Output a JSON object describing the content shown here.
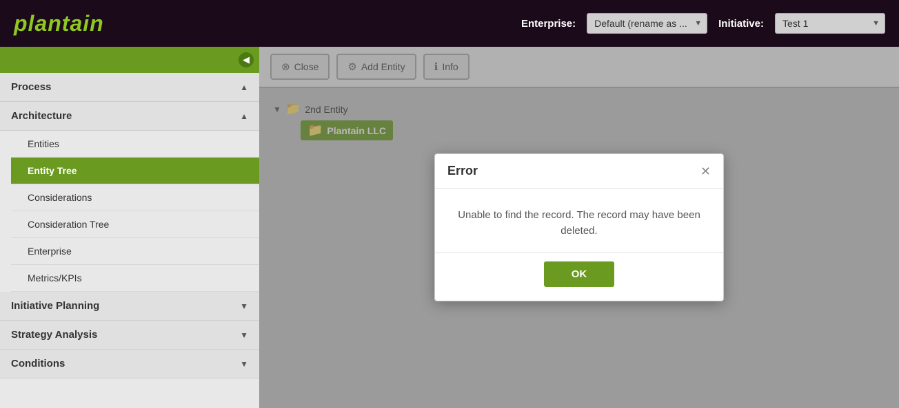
{
  "header": {
    "logo": "plantain",
    "enterprise_label": "Enterprise:",
    "enterprise_value": "Default (rename as ...",
    "initiative_label": "Initiative:",
    "initiative_value": "Test 1"
  },
  "toolbar": {
    "close_label": "Close",
    "add_entity_label": "Add Entity",
    "info_label": "Info"
  },
  "sidebar": {
    "collapse_label": "◀",
    "sections": [
      {
        "id": "process",
        "label": "Process",
        "chevron": "▲",
        "items": []
      },
      {
        "id": "architecture",
        "label": "Architecture",
        "chevron": "▲",
        "items": [
          {
            "id": "entities",
            "label": "Entities",
            "active": false
          },
          {
            "id": "entity-tree",
            "label": "Entity Tree",
            "active": true
          },
          {
            "id": "considerations",
            "label": "Considerations",
            "active": false
          },
          {
            "id": "consideration-tree",
            "label": "Consideration Tree",
            "active": false
          },
          {
            "id": "enterprise",
            "label": "Enterprise",
            "active": false
          },
          {
            "id": "metrics-kpis",
            "label": "Metrics/KPIs",
            "active": false
          }
        ]
      },
      {
        "id": "initiative-planning",
        "label": "Initiative Planning",
        "chevron": "▼",
        "items": []
      },
      {
        "id": "strategy-analysis",
        "label": "Strategy Analysis",
        "chevron": "▼",
        "items": []
      },
      {
        "id": "conditions",
        "label": "Conditions",
        "chevron": "▼",
        "items": []
      }
    ]
  },
  "tree": {
    "root_label": "2nd Entity",
    "child_label": "Plantain LLC"
  },
  "modal": {
    "title": "Error",
    "message": "Unable to find the record. The record may have been deleted.",
    "ok_label": "OK"
  },
  "icons": {
    "close_symbol": "⊗",
    "gear_symbol": "⚙",
    "info_symbol": "ℹ",
    "collapse_arrow": "◀"
  }
}
